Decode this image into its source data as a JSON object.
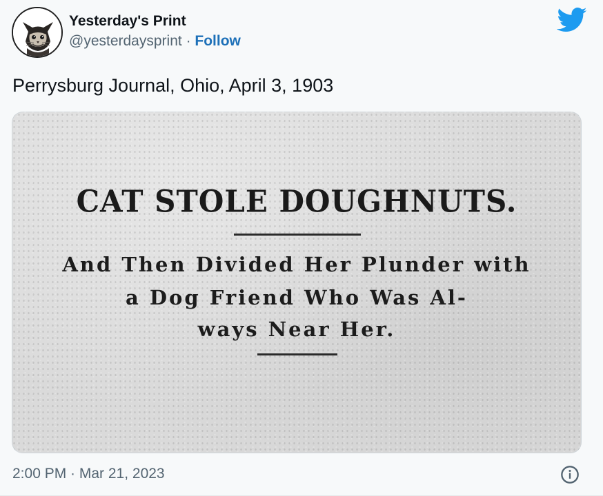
{
  "author": {
    "display_name": "Yesterday's Print",
    "handle": "@yesterdaysprint",
    "separator": "·",
    "follow_label": "Follow"
  },
  "tweet": {
    "text": "Perrysburg Journal, Ohio, April 3, 1903",
    "timestamp": "2:00 PM · Mar 21, 2023"
  },
  "media": {
    "headline": "CAT STOLE DOUGHNUTS.",
    "subhead_lines": [
      "And Then Divided Her Plunder with",
      "a Dog Friend Who Was Al-",
      "ways Near Her."
    ]
  },
  "icons": {
    "brand": "twitter-bird-icon",
    "info": "info-icon"
  },
  "colors": {
    "brand_blue": "#1d9bf0",
    "follow_link": "#1d70b8",
    "secondary_text": "#536471",
    "primary_text": "#0f1419",
    "background": "#f7f9fa"
  }
}
